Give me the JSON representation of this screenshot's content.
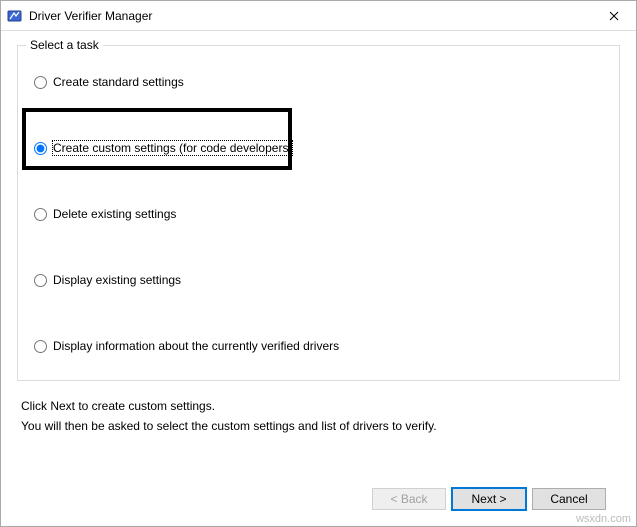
{
  "window": {
    "title": "Driver Verifier Manager"
  },
  "group": {
    "legend": "Select a task"
  },
  "options": {
    "create_standard": "Create standard settings",
    "create_custom": "Create custom settings (for code developers)",
    "delete_existing": "Delete existing settings",
    "display_existing": "Display existing settings",
    "display_info": "Display information about the currently verified drivers"
  },
  "selected_option": "create_custom",
  "instructions": {
    "line1": "Click Next to create custom settings.",
    "line2": "You will then be asked to select the custom settings and list of drivers to verify."
  },
  "buttons": {
    "back": "< Back",
    "next": "Next >",
    "cancel": "Cancel"
  },
  "watermark": "wsxdn.com"
}
